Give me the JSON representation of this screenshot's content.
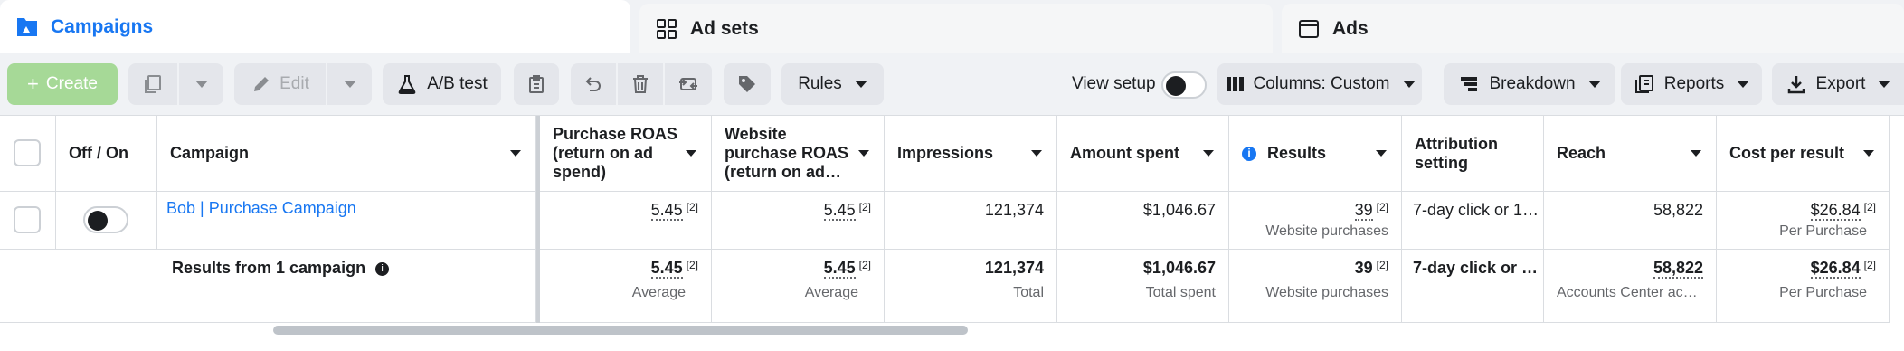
{
  "tabs": [
    {
      "label": "Campaigns",
      "icon": "folder-icon",
      "active": true
    },
    {
      "label": "Ad sets",
      "icon": "grid-icon",
      "active": false
    },
    {
      "label": "Ads",
      "icon": "window-icon",
      "active": false
    }
  ],
  "toolbar": {
    "create_label": "Create",
    "edit_label": "Edit",
    "ab_test_label": "A/B test",
    "rules_label": "Rules",
    "view_setup_label": "View setup",
    "columns_label": "Columns: Custom",
    "breakdown_label": "Breakdown",
    "reports_label": "Reports",
    "export_label": "Export"
  },
  "table": {
    "headers": {
      "off_on": "Off / On",
      "campaign": "Campaign",
      "purchase_roas": "Purchase ROAS (return on ad spend)",
      "website_roas": "Website purchase ROAS (return on ad…",
      "impressions": "Impressions",
      "amount_spent": "Amount spent",
      "results": "Results",
      "attribution": "Attribution setting",
      "reach": "Reach",
      "cost_per_result": "Cost per result"
    },
    "row": {
      "campaign": "Bob | Purchase Campaign",
      "purchase_roas": "5.45",
      "purchase_roas_sup": "[2]",
      "website_roas": "5.45",
      "website_roas_sup": "[2]",
      "impressions": "121,374",
      "amount_spent": "$1,046.67",
      "results": "39",
      "results_sup": "[2]",
      "results_sub": "Website purchases",
      "attribution": "7-day click or 1…",
      "reach": "58,822",
      "cost_per_result": "$26.84",
      "cost_per_result_sup": "[2]",
      "cost_per_result_sub": "Per Purchase"
    },
    "summary": {
      "label": "Results from 1 campaign",
      "purchase_roas": "5.45",
      "purchase_roas_sup": "[2]",
      "purchase_roas_sub": "Average",
      "website_roas": "5.45",
      "website_roas_sup": "[2]",
      "website_roas_sub": "Average",
      "impressions": "121,374",
      "impressions_sub": "Total",
      "amount_spent": "$1,046.67",
      "amount_spent_sub": "Total spent",
      "results": "39",
      "results_sup": "[2]",
      "results_sub": "Website purchases",
      "attribution": "7-day click or …",
      "reach": "58,822",
      "reach_sub": "Accounts Center acco…",
      "cost_per_result": "$26.84",
      "cost_per_result_sup": "[2]",
      "cost_per_result_sub": "Per Purchase"
    }
  },
  "colors": {
    "accent": "#1877f2",
    "create_button": "#a6d997",
    "toolbar_bg": "#f0f2f5"
  }
}
